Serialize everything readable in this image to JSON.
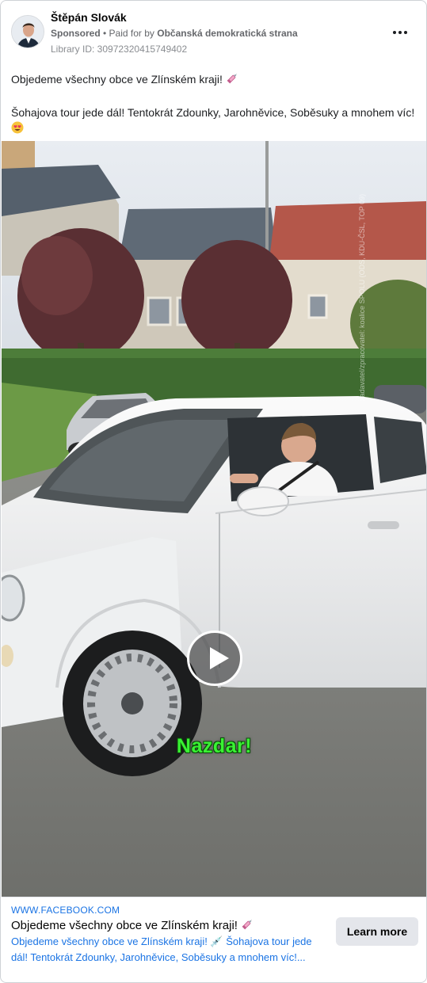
{
  "advertiser": {
    "name": "Štěpán Slovák",
    "sponsored_label": "Sponsored",
    "paid_for_prefix": " • Paid for by ",
    "paid_for_by": "Občanská demokratická strana",
    "library_id": "Library ID: 30972320415749402"
  },
  "post": {
    "line1": "Objedeme všechny obce ve Zlínském kraji!",
    "line2": "Šohajova tour jede dál! Tentokrát Zdounky, Jarohněvice, Soběsuky a mnohem víc!"
  },
  "video": {
    "caption": "Nazdar!",
    "watermark": "zadavatel/zpracovatel: koalice SPOLU (ODS, KDU-ČSL, TOP 09)"
  },
  "link_card": {
    "domain": "WWW.FACEBOOK.COM",
    "title": "Objedeme všechny obce ve Zlínském kraji!",
    "description": "Objedeme všechny obce ve Zlínském kraji! 💉 Šohajova tour jede dál! Tentokrát Zdounky, Jarohněvice, Soběsuky a mnohem víc!...",
    "button_label": "Learn more"
  },
  "icons": {
    "menu": "more-options-icon",
    "play": "play-icon",
    "syringe": "syringe-emoji-icon",
    "heart_eyes": "heart-eyes-emoji-icon"
  },
  "colors": {
    "link_blue": "#1b74e4",
    "caption_green": "#39f233",
    "button_grey": "#e4e6eb"
  }
}
